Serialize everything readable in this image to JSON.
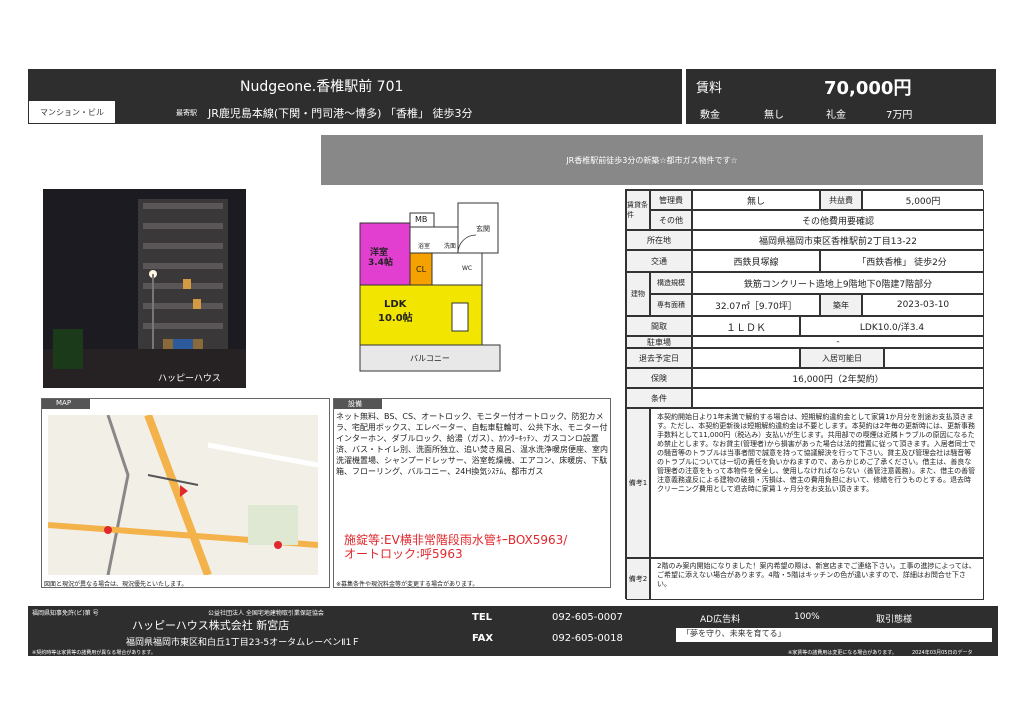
{
  "header": {
    "title": "Nudgeone.香椎駅前 701",
    "category": "マンション・ビル",
    "station_label": "最寄駅",
    "station": "JR鹿児島本線(下関・門司港～博多) 「香椎」 徒歩3分",
    "rent_label": "賃料",
    "rent_value": "70,000円",
    "deposit_label": "敷金",
    "deposit_value": "無し",
    "key_label": "礼金",
    "key_value": "7万円"
  },
  "banner": {
    "text": "JR香椎駅前徒歩3分の新築☆都市ガス物件です☆"
  },
  "photo": {
    "watermark": "ハッピーハウス"
  },
  "floorplan": {
    "rooms": {
      "mb": "MB",
      "genkan": "玄関",
      "yoshitsu": "洋室",
      "yoshitsu_size": "3.4帖",
      "bath": "浴室",
      "sen": "洗面",
      "cl": "CL",
      "wc": "WC",
      "ldk": "LDK",
      "ldk_size": "10.0帖",
      "balcony": "バルコニー"
    }
  },
  "map": {
    "label": "MAP",
    "note": "図面と現況が異なる場合は、現況優先といたします。"
  },
  "facilities": {
    "label": "設備",
    "text": "ネット無料、BS、CS、オートロック、モニター付オートロック、防犯カメラ、宅配用ボックス、エレベーター、自転車駐輪可、公共下水、モニター付インターホン、ダブルロック、給湯（ガス）、ｶｳﾝﾀｰｷｯﾁﾝ、ガスコンロ設置済、バス・トイレ別、洗面所独立、追い焚き風呂、温水洗浄暖房便座、室内洗濯機置場、シャンプードレッサー、浴室乾燥機、エアコン、床暖房、下駄箱、フローリング、バルコニー、24H換気ｼｽﾃﾑ、都市ガス",
    "lock_line1": "施錠等:EV横非常階段雨水管ｷｰBOX5963/",
    "lock_line2": "オートロック:呼5963",
    "note": "※募集条件や現況料金等が変更する場合があります。"
  },
  "table": {
    "rent_group": "賃貸条件",
    "mgmt_label": "管理費",
    "mgmt_value": "無し",
    "common_label": "共益費",
    "common_value": "5,000円",
    "other_label": "その他",
    "other_value": "その他費用要確認",
    "addr_label": "所在地",
    "addr_value": "福岡県福岡市東区香椎駅前2丁目13-22",
    "traffic_label": "交通",
    "traffic_value1": "西鉄貝塚線",
    "traffic_value2": "「西鉄香椎」 徒歩2分",
    "bld_group": "建物",
    "structure_label": "構造規模",
    "structure_value": "鉄筋コンクリート造地上9階地下0階建7階部分",
    "area_label": "専有面積",
    "area_value": "32.07㎡［9.70坪］",
    "built_label": "築年",
    "built_value": "2023-03-10",
    "layout_label": "間取",
    "layout_value": "１ＬＤＫ",
    "layout_detail": "LDK10.0/洋3.4",
    "parking_label": "駐車場",
    "parking_value": "-",
    "moveout_label": "退去予定日",
    "movein_label": "入居可能日",
    "insurance_label": "保険",
    "insurance_value": "16,000円（2年契約）",
    "cond_label": "条件",
    "remark1_label": "備考1",
    "remark1_text": "本契約開始日より1年未満で解約する場合は、短期解約違約金として家賃1か月分を別途お支払頂きます。ただし、本契約更新後は短期解約違約金は不要とします。本契約は2年毎の更新時には、更新事務手数料として11,000円（税込み）支払いが生じます。共用部での喫煙は近隣トラブルの原因になるため禁止とします。なお貸主(管理者)から損害があった場合は法的措置に従って頂きます。入居者同士での騒音等のトラブルは当事者間で誠意を持って協議解決を行って下さい。貸主及び管理会社は騒音等のトラブルについては一切の責任を負いかねますので、あらかじめご了承ください。借主は、善良な管理者の注意をもって本物件を保全し、使用しなければならない（善管注意義務）。また、借主の善管注意義務違反による建物の破損・汚損は、借主の費用負担において、修繕を行うものとする。退去時クリーニング費用として退去時に家賃１ヶ月分をお支払い頂きます。",
    "remark2_label": "備考2",
    "remark2_text": "2階のみ案内開始になりました！案内希望の際は、新宮店までご連絡下さい。工事の進捗によっては、ご希望に添えない場合があります。4階・5階はキッチンの色が違いますので、詳細はお問合せ下さい。"
  },
  "footer": {
    "license_small": "福岡県知事免許(ビ)第 号",
    "assoc_small": "公益社団法人 全国宅地建物取引業保証協会",
    "company": "ハッピーハウス株式会社 新宮店",
    "address": "福岡県福岡市東区和白丘1丁目23-5オータムレーベンⅡ1Ｆ",
    "tel_label": "TEL",
    "tel": "092-605-0007",
    "fax_label": "FAX",
    "fax": "092-605-0018",
    "ad_label": "AD広告料",
    "ad_value": "100%",
    "deal_label": "取引態様",
    "slogan": "「夢を守り、未来を育てる」",
    "bottom_left": "※契約時等は家賃等の諸費用が異なる場合があります。",
    "bottom_mid": "※家賃等の諸費用は変更になる場合があります。",
    "bottom_right": "2024年03月05日のデータ"
  },
  "colors": {
    "header_bg": "#2e2e2e",
    "yoshitsu": "#e23fd1",
    "ldk": "#f2e600",
    "cl": "#f5a100",
    "red_text": "#e0282d"
  }
}
